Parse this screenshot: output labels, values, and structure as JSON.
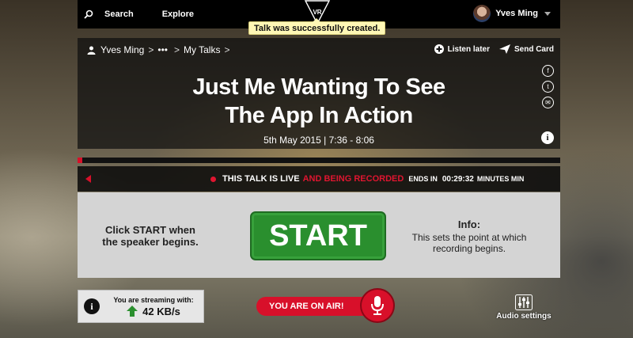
{
  "topbar": {
    "search_label": "Search",
    "explore_label": "Explore",
    "logo_text": "VR",
    "user_name": "Yves Ming"
  },
  "toast": {
    "message": "Talk was successfully created."
  },
  "breadcrumb": {
    "user": "Yves Ming",
    "ellipsis": "•••",
    "section": "My Talks",
    "sep": ">"
  },
  "actions": {
    "listen_later": "Listen later",
    "send_card": "Send Card"
  },
  "talk": {
    "title_line1": "Just Me Wanting To See",
    "title_line2": "The App In Action",
    "date": "5th May 2015 | 7:36 - 8:06"
  },
  "socials": {
    "facebook": "f",
    "twitter": "t",
    "email": "✉"
  },
  "info_symbol": "i",
  "progress": {
    "fraction": 0.01
  },
  "live": {
    "status_white": "THIS TALK IS LIVE",
    "status_red": "AND BEING RECORDED",
    "ends_label": "ENDS IN",
    "timer": "00:29:32",
    "minutes_label": "MINUTES MIN"
  },
  "start_panel": {
    "hint": "Click START when the speaker begins.",
    "start_label": "START",
    "info_heading": "Info:",
    "info_text": "This sets the point at which recording begins."
  },
  "stream": {
    "label": "You are streaming with:",
    "value": "42 KB/s"
  },
  "onair": {
    "label": "YOU ARE ON AIR!"
  },
  "audio": {
    "label": "Audio settings"
  },
  "colors": {
    "accent_red": "#d8102a",
    "start_green": "#2a8f2e",
    "toast_bg": "#fff7b5"
  },
  "icons": [
    "search-icon",
    "person-icon",
    "plus-circle-icon",
    "send-icon",
    "facebook-icon",
    "twitter-icon",
    "email-icon",
    "info-icon",
    "back-arrow-icon",
    "up-arrow-icon",
    "microphone-icon",
    "sliders-icon"
  ]
}
